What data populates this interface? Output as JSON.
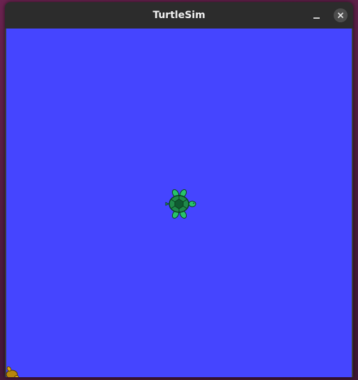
{
  "window": {
    "title": "TurtleSim"
  },
  "canvas": {
    "background_color": "#4545ff"
  },
  "turtle": {
    "icon": "turtle-icon",
    "shell_color": "#1f8a4a",
    "heading": "east"
  },
  "controls": {
    "minimize_icon": "minimize-icon",
    "close_icon": "close-icon"
  }
}
